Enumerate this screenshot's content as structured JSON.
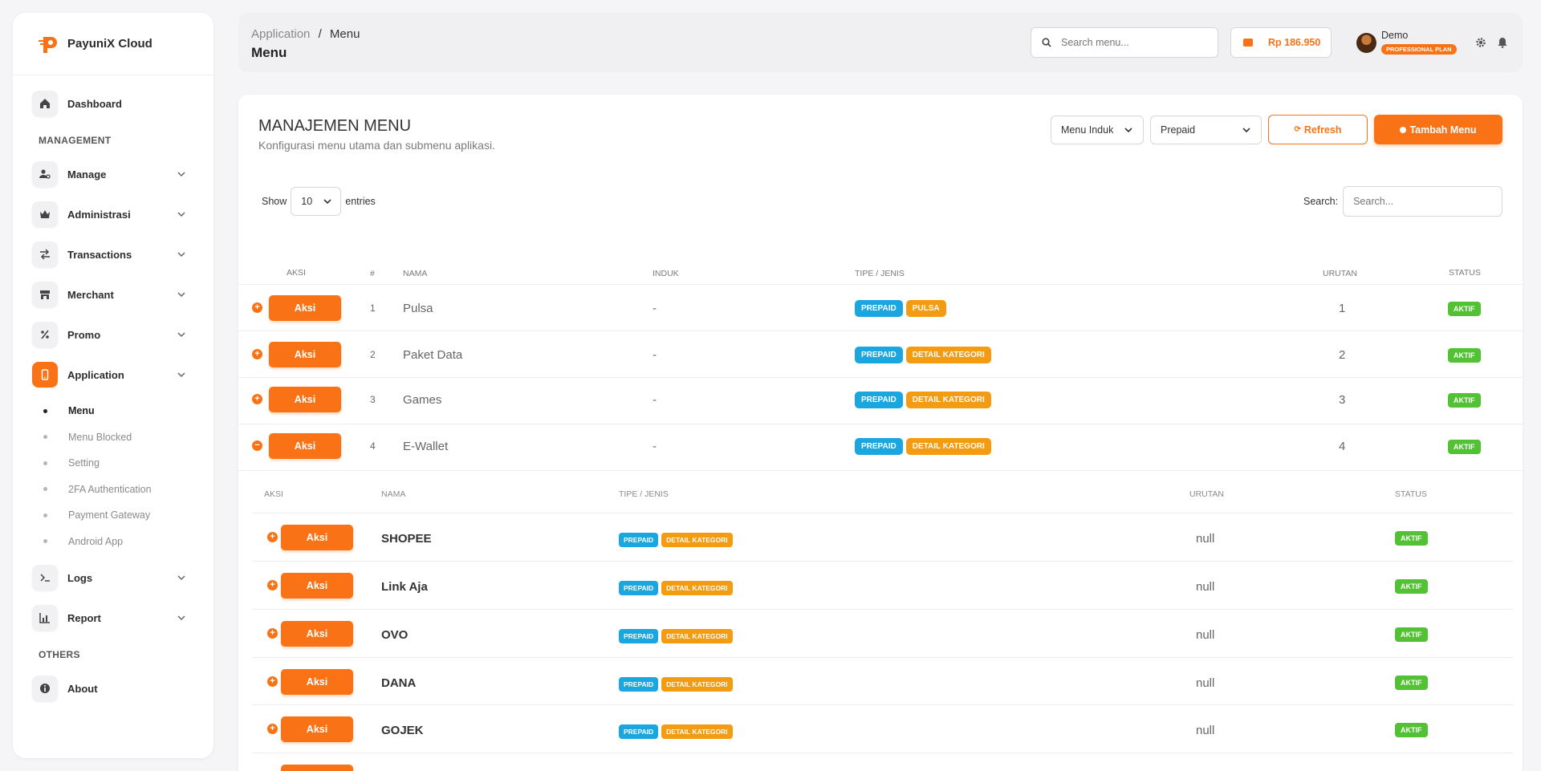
{
  "app": {
    "name": "PayuniX Cloud"
  },
  "sidebar": {
    "dashboard": "Dashboard",
    "sections": {
      "management": "MANAGEMENT",
      "others": "OTHERS"
    },
    "items": [
      {
        "label": "Manage"
      },
      {
        "label": "Administrasi"
      },
      {
        "label": "Transactions"
      },
      {
        "label": "Merchant"
      },
      {
        "label": "Promo"
      },
      {
        "label": "Application"
      }
    ],
    "application_sub": [
      "Menu",
      "Menu Blocked",
      "Setting",
      "2FA Authentication",
      "Payment Gateway",
      "Android App"
    ],
    "logs": "Logs",
    "report": "Report",
    "about": "About"
  },
  "header": {
    "breadcrumb_parent": "Application",
    "breadcrumb_sep": "/",
    "breadcrumb_current": "Menu",
    "title": "Menu",
    "search_placeholder": "Search menu...",
    "balance": "Rp 186.950",
    "user_name": "Demo",
    "user_plan": "PROFESSIONAL PLAN"
  },
  "card": {
    "title": "MANAJEMEN MENU",
    "subtitle": "Konfigurasi menu utama dan submenu aplikasi.",
    "filter_parent": "Menu Induk",
    "filter_type": "Prepaid",
    "refresh_label": "Refresh",
    "add_label": "Tambah Menu",
    "show_label": "Show",
    "entries_value": "10",
    "entries_label": "entries",
    "search_label": "Search:",
    "search_placeholder": "Search..."
  },
  "table": {
    "headers": {
      "aksi": "AKSI",
      "no": "#",
      "nama": "NAMA",
      "induk": "INDUK",
      "tipe": "TIPE / JENIS",
      "urutan": "URUTAN",
      "status": "STATUS"
    },
    "action_label": "Aksi",
    "rows": [
      {
        "no": "1",
        "nama": "Pulsa",
        "induk": "-",
        "badge1": "PREPAID",
        "badge2": "PULSA",
        "urutan": "1",
        "status": "AKTIF",
        "toggle": "+"
      },
      {
        "no": "2",
        "nama": "Paket Data",
        "induk": "-",
        "badge1": "PREPAID",
        "badge2": "DETAIL KATEGORI",
        "urutan": "2",
        "status": "AKTIF",
        "toggle": "+"
      },
      {
        "no": "3",
        "nama": "Games",
        "induk": "-",
        "badge1": "PREPAID",
        "badge2": "DETAIL KATEGORI",
        "urutan": "3",
        "status": "AKTIF",
        "toggle": "+"
      },
      {
        "no": "4",
        "nama": "E-Wallet",
        "induk": "-",
        "badge1": "PREPAID",
        "badge2": "DETAIL KATEGORI",
        "urutan": "4",
        "status": "AKTIF",
        "toggle": "−"
      }
    ]
  },
  "subtable": {
    "headers": {
      "aksi": "AKSI",
      "nama": "NAMA",
      "tipe": "TIPE / JENIS",
      "urutan": "URUTAN",
      "status": "STATUS"
    },
    "rows": [
      {
        "nama": "SHOPEE",
        "badge1": "PREPAID",
        "badge2": "DETAIL KATEGORI",
        "urutan": "null",
        "status": "AKTIF"
      },
      {
        "nama": "Link Aja",
        "badge1": "PREPAID",
        "badge2": "DETAIL KATEGORI",
        "urutan": "null",
        "status": "AKTIF"
      },
      {
        "nama": "OVO",
        "badge1": "PREPAID",
        "badge2": "DETAIL KATEGORI",
        "urutan": "null",
        "status": "AKTIF"
      },
      {
        "nama": "DANA",
        "badge1": "PREPAID",
        "badge2": "DETAIL KATEGORI",
        "urutan": "null",
        "status": "AKTIF"
      },
      {
        "nama": "GOJEK",
        "badge1": "PREPAID",
        "badge2": "DETAIL KATEGORI",
        "urutan": "null",
        "status": "AKTIF"
      }
    ]
  },
  "colors": {
    "accent": "#f97316",
    "prepaid": "#1aa7e0",
    "category": "#f39c12",
    "active": "#52c234"
  }
}
